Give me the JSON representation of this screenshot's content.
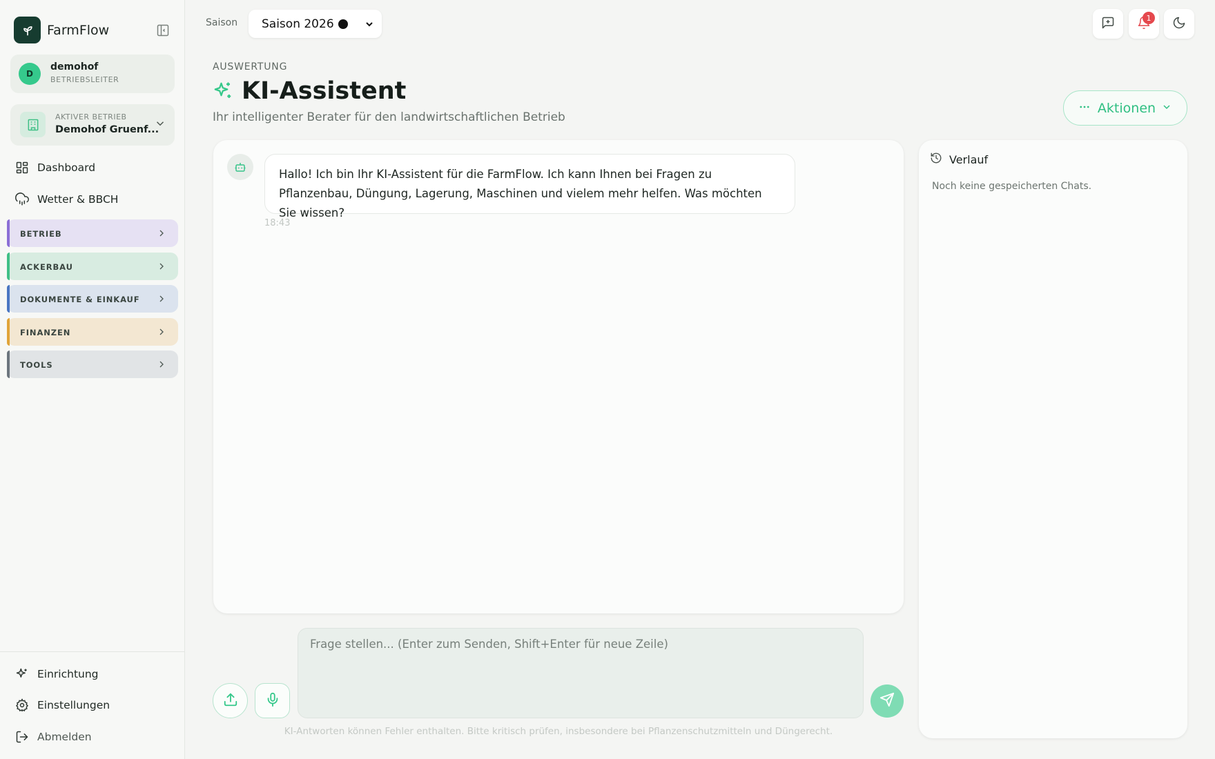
{
  "brand": {
    "name": "FarmFlow"
  },
  "user": {
    "initial": "D",
    "name": "demohof",
    "role": "BETRIEBSLEITER"
  },
  "farm": {
    "label": "AKTIVER BETRIEB",
    "name": "Demohof Gruenf..."
  },
  "nav": {
    "dashboard": "Dashboard",
    "weather": "Wetter & BBCH"
  },
  "groups": [
    {
      "label": "BETRIEB",
      "bg": "#e6e1f3",
      "accent": "#8b6fd6"
    },
    {
      "label": "ACKERBAU",
      "bg": "#d8ece1",
      "accent": "#3fbf86"
    },
    {
      "label": "DOKUMENTE & EINKAUF",
      "bg": "#dbe3ee",
      "accent": "#4a76c2"
    },
    {
      "label": "FINANZEN",
      "bg": "#f3e7d2",
      "accent": "#e0a43a"
    },
    {
      "label": "TOOLS",
      "bg": "#e1e4e6",
      "accent": "#6c757d"
    }
  ],
  "footer_nav": {
    "setup": "Einrichtung",
    "settings": "Einstellungen",
    "logout": "Abmelden"
  },
  "topbar": {
    "season_label": "Saison",
    "season_value": "Saison 2026",
    "notification_count": "1"
  },
  "header": {
    "overline": "AUSWERTUNG",
    "title": "KI-Assistent",
    "subtitle": "Ihr intelligenter Berater für den landwirtschaftlichen Betrieb",
    "actions_label": "Aktionen"
  },
  "chat": {
    "messages": [
      {
        "text": "Hallo! Ich bin Ihr KI-Assistent für die FarmFlow. Ich kann Ihnen bei Fragen zu Pflanzenbau, Düngung, Lagerung, Maschinen und vielem mehr helfen. Was möchten Sie wissen?",
        "time": "18:43"
      }
    ]
  },
  "history": {
    "title": "Verlauf",
    "empty": "Noch keine gespeicherten Chats."
  },
  "composer": {
    "placeholder": "Frage stellen... (Enter zum Senden, Shift+Enter für neue Zeile)",
    "disclaimer": "KI-Antworten können Fehler enthalten. Bitte kritisch prüfen, insbesondere bei Pflanzenschutzmitteln und Düngerecht."
  },
  "colors": {
    "accent": "#36c88a",
    "sidebar_bg": "#f7f8f6",
    "page_bg": "#f4f5f3",
    "badge": "#e5484d"
  }
}
